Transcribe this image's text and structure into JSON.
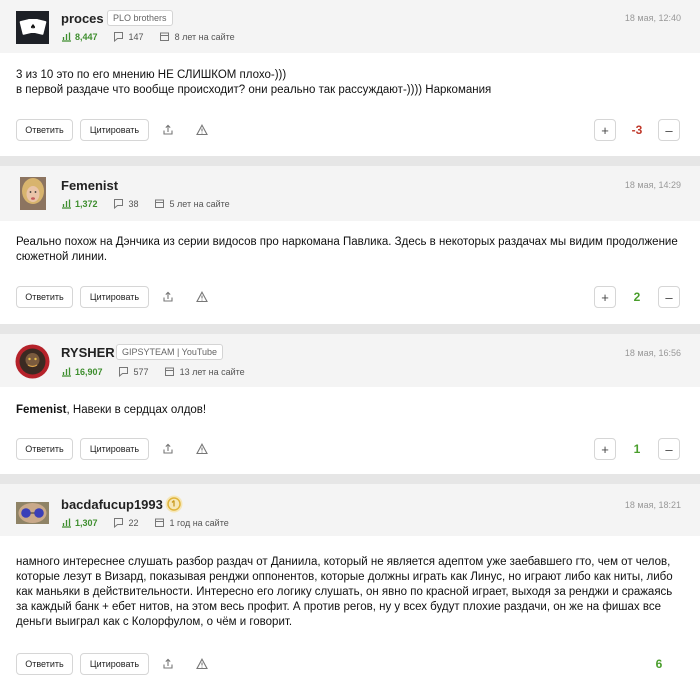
{
  "labels": {
    "reply": "Ответить",
    "quote": "Цитировать",
    "plus": "+",
    "minus": "–"
  },
  "comments": [
    {
      "username": "proces",
      "badge": "PLO brothers",
      "date": "18 мая, 12:40",
      "rating": "8,447",
      "comments": "147",
      "since": "8 лет на сайте",
      "text_lines": [
        "3 из 10 это по его мнению НЕ СЛИШКОМ плохо-)))",
        "в первой раздаче что вообще происходит? они реально так рассуждают-)))) Наркомания"
      ],
      "score": "-3",
      "avatar_icon": "playing-cards-avatar-icon"
    },
    {
      "username": "Femenist",
      "badge": "",
      "date": "18 мая, 14:29",
      "rating": "1,372",
      "comments": "38",
      "since": "5 лет на сайте",
      "text_lines": [
        "Реально похож на Дэнчика из серии видосов про наркомана Павлика. Здесь в некоторых раздачах мы видим продолжение",
        "сюжетной линии."
      ],
      "score": "2",
      "avatar_icon": "user-photo-avatar-icon"
    },
    {
      "username": "RYSHER",
      "badge": "GIPSYTEAM | YouTube",
      "date": "18 мая, 16:56",
      "rating": "16,907",
      "comments": "577",
      "since": "13 лет на сайте",
      "mention": "Femenist",
      "text_rest": ", Навеки в сердцах олдов!",
      "score": "1",
      "avatar_icon": "round-emblem-avatar-icon"
    },
    {
      "username": "bacdafucup1993",
      "badge": "",
      "date": "18 мая, 18:21",
      "rating": "1,307",
      "comments": "22",
      "since": "1 год на сайте",
      "text_lines": [
        "намного интереснее слушать разбор раздач от Даниила, который не является адептом уже заебавшего гто, чем от челов,",
        "которые лезут в Визард, показывая ренджи оппонентов, которые должны играть как Линус, но играют либо как ниты, либо",
        "как маньяки в действительности. Интересно его логику слушать, он явно по красной играет, выходя за ренджи и сражаясь",
        "за каждый банк + ебет нитов, на этом весь профит. А против регов, ну у всех будут плохие раздачи, он же на фишах все",
        "деньги выиграл как с Колорфулом, о чём и говорит."
      ],
      "score": "6",
      "avatar_icon": "sunglasses-avatar-icon"
    }
  ],
  "colors": {
    "positive": "#4a9e2c",
    "negative": "#c0392b",
    "rating": "#3e8e2e",
    "medal": "#e0b43a"
  }
}
